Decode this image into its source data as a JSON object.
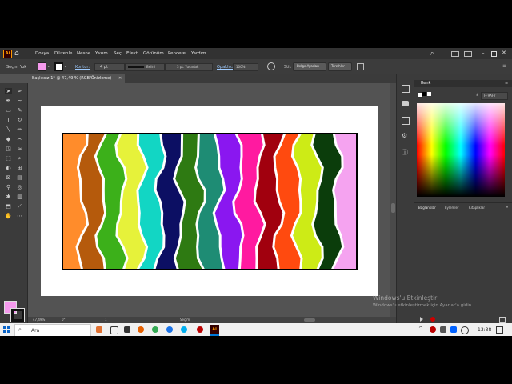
{
  "app": {
    "logo": "Ai",
    "menus": [
      "Dosya",
      "Düzenle",
      "Nesne",
      "Yazım",
      "Seç",
      "Efekt",
      "Görünüm",
      "Pencere",
      "Yardım"
    ]
  },
  "control_bar": {
    "selection_label": "Seçim Yok",
    "fill_color": "#F59AED",
    "stroke_label": "Kontur:",
    "stroke_value": "4 pt",
    "stroke_style": "Belirli",
    "brush_label": "3 pt. Yuvarlak",
    "opacity_label": "Opaklık:",
    "opacity_value": "100%",
    "style_label": "Stil:",
    "doc_setup_button": "Belge Ayarları",
    "preferences_button": "Tercihler"
  },
  "document": {
    "tab_title": "Başlıksız-1* @ 47,49 % (RGB/Önizleme)"
  },
  "color_panel": {
    "title": "Renk",
    "hex_prefix": "#",
    "hex_value": "FF9AF7"
  },
  "bottom_panel_tabs": [
    "Bağlantılar",
    "Eylemler",
    "Kitaplıklar"
  ],
  "status": {
    "zoom": "47,49%",
    "rotation": "0°",
    "artboard": "1",
    "mode": "Seçim"
  },
  "watermark": {
    "title": "Windows'u Etkinleştir",
    "subtitle": "Windows'u etkinleştirmek için Ayarlar'a gidin."
  },
  "taskbar": {
    "search_placeholder": "Ara",
    "clock": "13:38",
    "app_icon_label": "Ai"
  },
  "artwork": {
    "stripe_colors": [
      "#FF8C2B",
      "#B55A0C",
      "#3CB01A",
      "#E6F23A",
      "#12D6C4",
      "#0C0F63",
      "#2E7A12",
      "#1E8C74",
      "#8A17F0",
      "#FF1AA0",
      "#A1000E",
      "#FF4A0F",
      "#CDEB16",
      "#0B3D0B",
      "#F5A3F0"
    ]
  }
}
